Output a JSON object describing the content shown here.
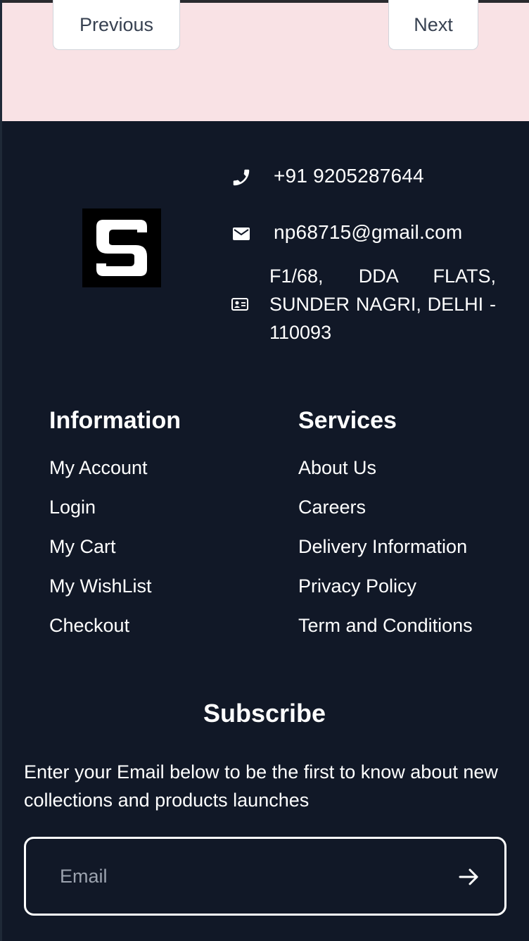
{
  "pagination": {
    "previous_label": "Previous",
    "next_label": "Next"
  },
  "footer": {
    "logo_icon": "s-logo-icon",
    "contact": {
      "phone": "+91 9205287644",
      "phone_icon": "phone-icon",
      "email": "np68715@gmail.com",
      "email_icon": "envelope-icon",
      "address": "F1/68, DDA FLATS, SUNDER NAGRI, DELHI - 110093",
      "address_icon": "id-card-icon"
    },
    "information": {
      "title": "Information",
      "items": [
        "My Account",
        "Login",
        "My Cart",
        "My WishList",
        "Checkout"
      ]
    },
    "services": {
      "title": "Services",
      "items": [
        "About Us",
        "Careers",
        "Delivery Information",
        "Privacy Policy",
        "Term and Conditions"
      ]
    },
    "subscribe": {
      "title": "Subscribe",
      "description": "Enter your Email below to be the first to know about new collections and products launches",
      "placeholder": "Email",
      "submit_icon": "arrow-right-icon"
    }
  },
  "colors": {
    "footer_bg": "#111827",
    "pagination_bg": "#f9e2e5",
    "text": "#ffffff"
  }
}
